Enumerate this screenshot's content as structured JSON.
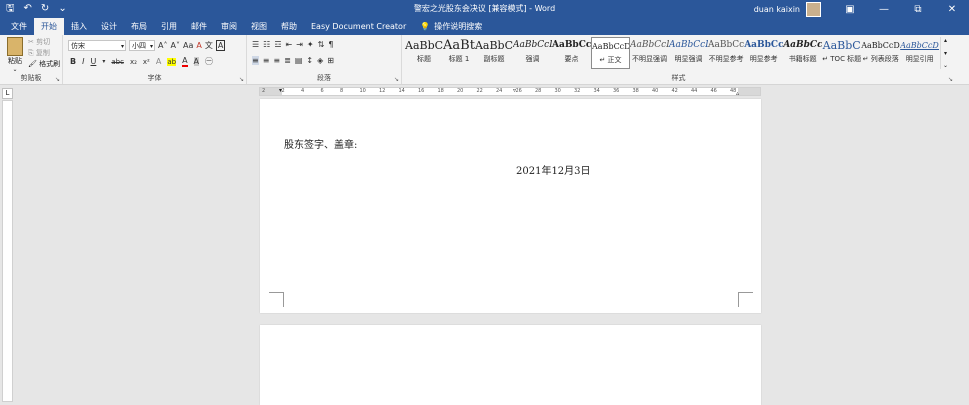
{
  "titlebar": {
    "title": "警宏之光股东会决议 [兼容模式] - Word",
    "user": "duan kaixin",
    "qat_icons": [
      "save-icon",
      "undo-icon",
      "redo-icon",
      "customize-icon"
    ],
    "min": "—",
    "restore": "⧉",
    "close": "✕",
    "ribbon_options": "▣"
  },
  "tabs": [
    "文件",
    "开始",
    "插入",
    "设计",
    "布局",
    "引用",
    "邮件",
    "审阅",
    "视图",
    "帮助",
    "Easy Document Creator"
  ],
  "tell_me": "操作说明搜索",
  "ribbon": {
    "clipboard": {
      "label": "剪贴板",
      "paste": "粘贴",
      "cut": "剪切",
      "copy": "复制",
      "format_painter": "格式刷"
    },
    "font": {
      "label": "字体",
      "font_name": "仿宋",
      "font_size": "小四",
      "grow": "A˄",
      "shrink": "A˅",
      "case": "Aa",
      "clear": "A",
      "bold": "B",
      "italic": "I",
      "underline": "U",
      "strike": "abc",
      "subscript": "x₂",
      "superscript": "x²",
      "effects": "A",
      "highlight": "ab",
      "color": "A",
      "shade": "A",
      "border": "A"
    },
    "paragraph": {
      "label": "段落"
    },
    "styles": {
      "label": "样式",
      "items": [
        {
          "preview": "AaBbC",
          "name": "标题"
        },
        {
          "preview": "AaBt",
          "name": "标题 1"
        },
        {
          "preview": "AaBbC",
          "name": "副标题"
        },
        {
          "preview": "AaBbCcL",
          "name": "强调"
        },
        {
          "preview": "AaBbCcl",
          "name": "要点"
        },
        {
          "preview": "AaBbCcDc",
          "name": "↵ 正文"
        },
        {
          "preview": "AaBbCcL",
          "name": "不明显强调"
        },
        {
          "preview": "AaBbCcL",
          "name": "明显强调"
        },
        {
          "preview": "AaBbCc",
          "name": "不明显参考"
        },
        {
          "preview": "AaBbCc",
          "name": "明显参考"
        },
        {
          "preview": "AaBbCc",
          "name": "书籍标题"
        },
        {
          "preview": "AaBbC",
          "name": "↵ TOC 标题"
        },
        {
          "preview": "AaBbCcDc",
          "name": "↵ 列表段落"
        },
        {
          "preview": "AaBbCcDc",
          "name": "明显引用"
        }
      ],
      "selected_index": 5
    }
  },
  "ruler": {
    "marks": [
      "2",
      "2",
      "4",
      "6",
      "8",
      "10",
      "12",
      "14",
      "16",
      "18",
      "20",
      "22",
      "24",
      "26",
      "28",
      "30",
      "32",
      "34",
      "36",
      "38",
      "40",
      "42",
      "44",
      "46",
      "48"
    ]
  },
  "vruler": {
    "tab_selector": "L"
  },
  "document": {
    "signature_line": "股东签字、盖章:",
    "date_line": "2021年12月3日"
  },
  "colors": {
    "accent": "#2b579a",
    "ribbon_bg": "#f3f3f3",
    "workspace": "#e6e6e6"
  }
}
